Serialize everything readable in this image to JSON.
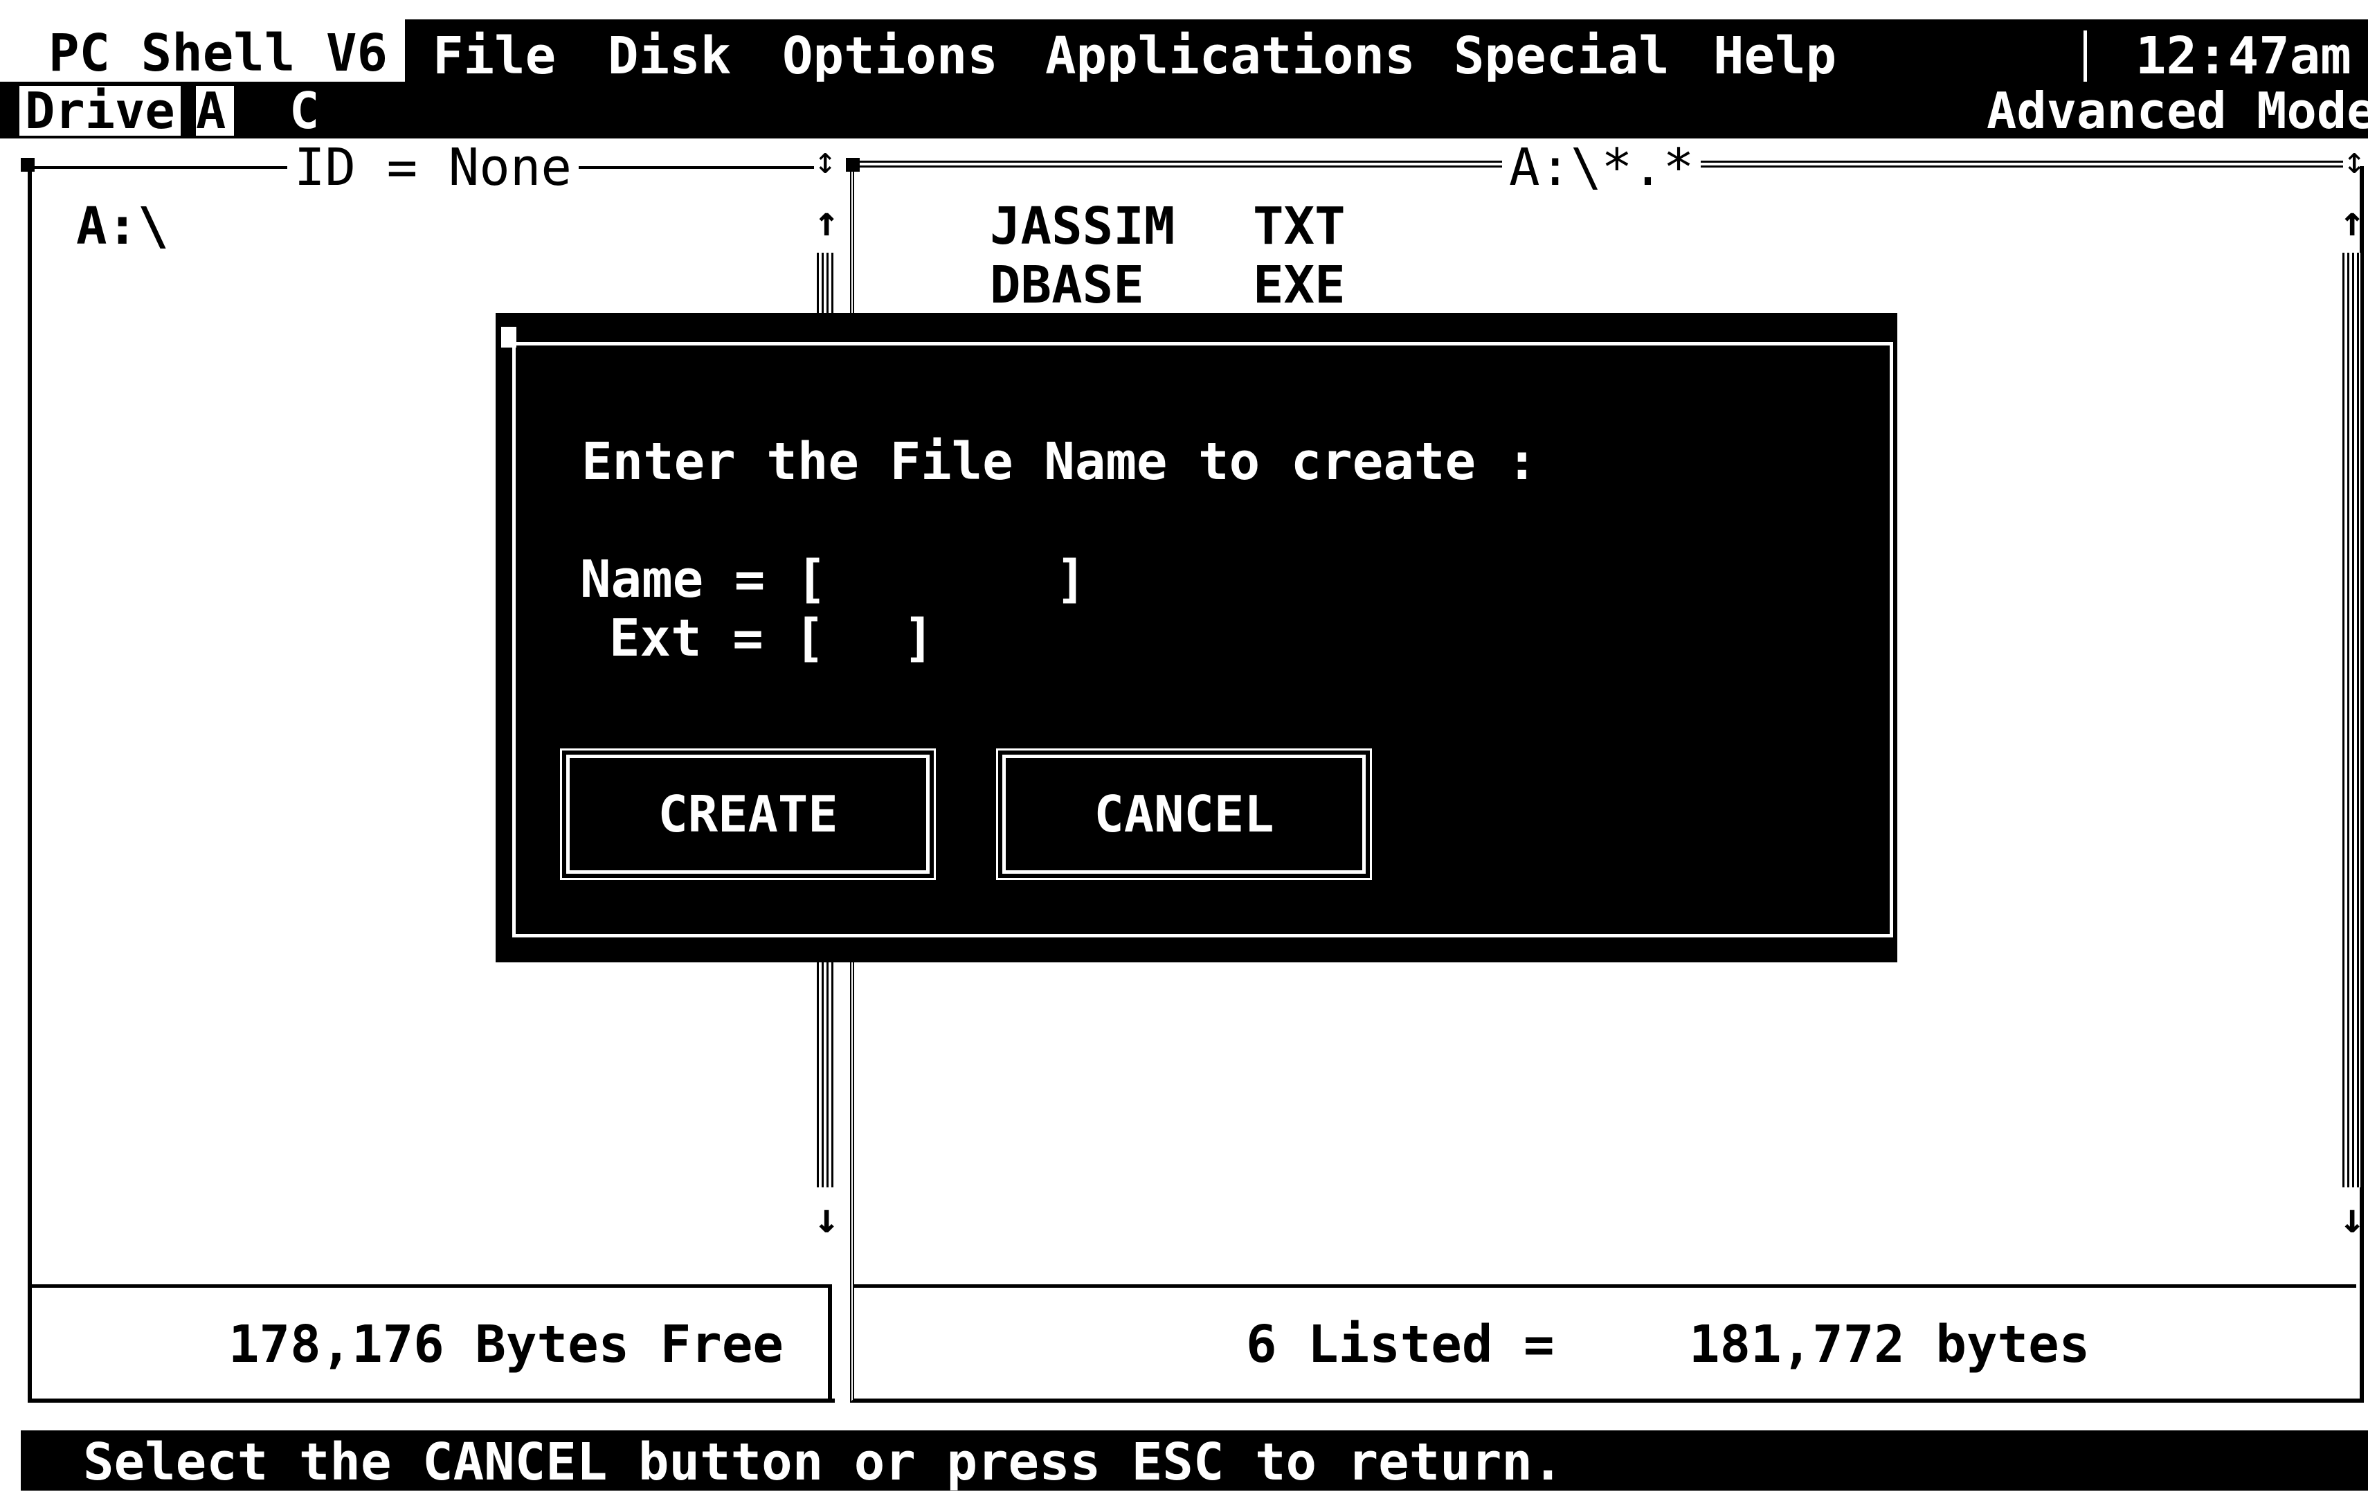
{
  "menubar": {
    "app_title": "PC Shell V6",
    "items": [
      "File",
      "Disk",
      "Options",
      "Applications",
      "Special",
      "Help"
    ],
    "clock": "12:47am"
  },
  "drivebar": {
    "label": "Drive",
    "drives": [
      "A",
      "C"
    ],
    "mode": "Advanced Mode"
  },
  "left_panel": {
    "header": "ID = None",
    "tree_root": "A:\\",
    "free_text": "178,176 Bytes Free"
  },
  "right_panel": {
    "header": "A:\\*.*",
    "files": [
      {
        "name": "JASSIM",
        "ext": "TXT"
      },
      {
        "name": "DBASE",
        "ext": "EXE"
      }
    ],
    "summary_count": "6 Listed =",
    "summary_bytes": "181,772 bytes"
  },
  "dialog": {
    "prompt": "Enter the File Name to create :",
    "name_label": "Name = [",
    "name_close": "]",
    "ext_label": "Ext = [",
    "ext_close": "]",
    "create_button": "CREATE",
    "cancel_button": "CANCEL"
  },
  "statusbar": {
    "text": "Select the CANCEL button or press ESC to return."
  }
}
